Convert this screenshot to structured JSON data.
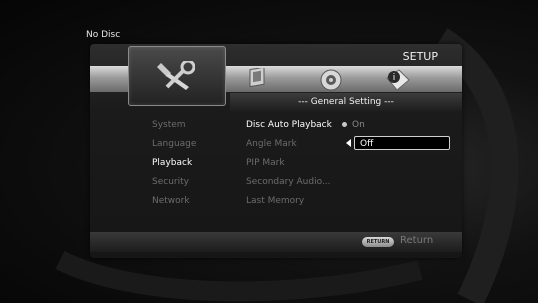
{
  "status": {
    "disc": "No Disc"
  },
  "header": {
    "title": "SETUP"
  },
  "tabs": [
    {
      "name": "general",
      "icon": "tools-icon"
    },
    {
      "name": "display",
      "icon": "display-icon"
    },
    {
      "name": "audio",
      "icon": "speaker-icon"
    },
    {
      "name": "information",
      "icon": "info-icon"
    }
  ],
  "section": {
    "title": "--- General Setting ---"
  },
  "categories": [
    "System",
    "Language",
    "Playback",
    "Security",
    "Network"
  ],
  "active_category": "Playback",
  "options": [
    "Disc Auto Playback",
    "Angle Mark",
    "PIP Mark",
    "Secondary Audio...",
    "Last Memory"
  ],
  "active_option": "Disc Auto Playback",
  "values": {
    "on": "On",
    "off": "Off"
  },
  "footer": {
    "return_key": "RETURN",
    "return_label": "Return"
  }
}
